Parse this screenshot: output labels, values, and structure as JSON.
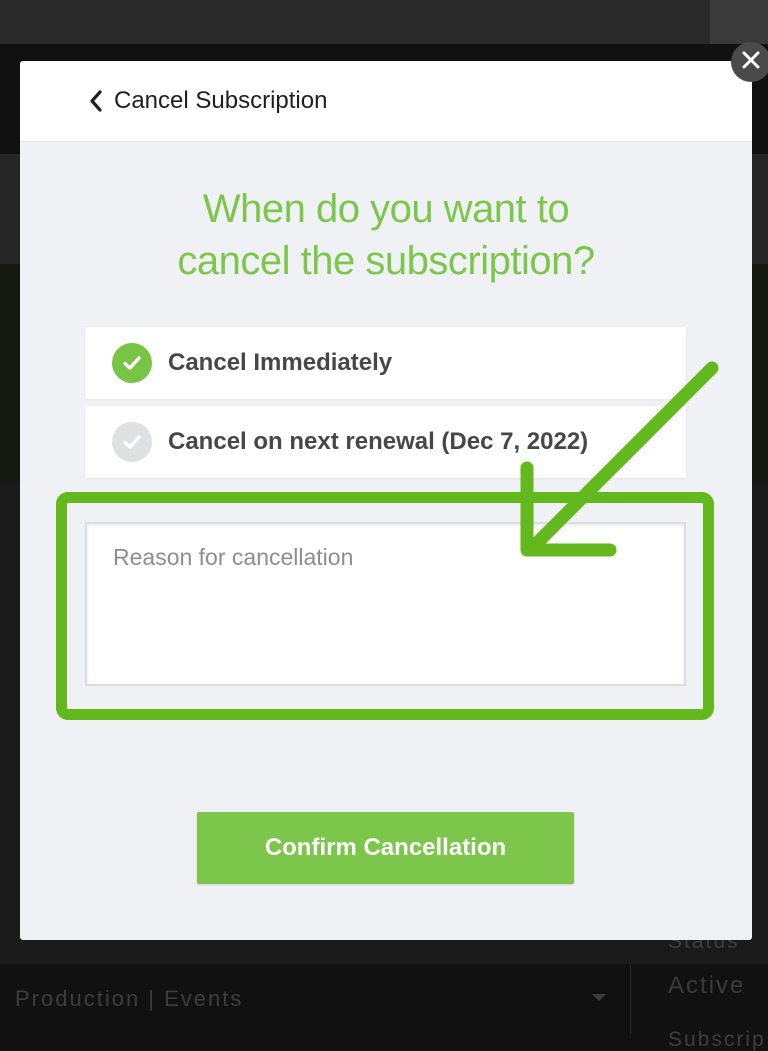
{
  "modal": {
    "back_label": "Cancel Subscription",
    "question_line1": "When do you want to",
    "question_line2": "cancel the subscription?",
    "options": [
      {
        "label": "Cancel Immediately",
        "selected": true
      },
      {
        "label": "Cancel on next renewal (Dec 7, 2022)",
        "selected": false
      }
    ],
    "reason_placeholder": "Reason for cancellation",
    "confirm_label": "Confirm Cancellation"
  },
  "background": {
    "select_value": "Production | Events",
    "status_label": "Status",
    "status_value": "Active",
    "subscription_label": "Subscrip"
  },
  "colors": {
    "accent": "#7dc64c",
    "annotation": "#62b81c",
    "check_off": "#dfe0e2",
    "modal_bg": "#f0f1f5"
  },
  "icons": {
    "back": "chevron-left-icon",
    "close": "close-icon",
    "check": "check-icon"
  }
}
